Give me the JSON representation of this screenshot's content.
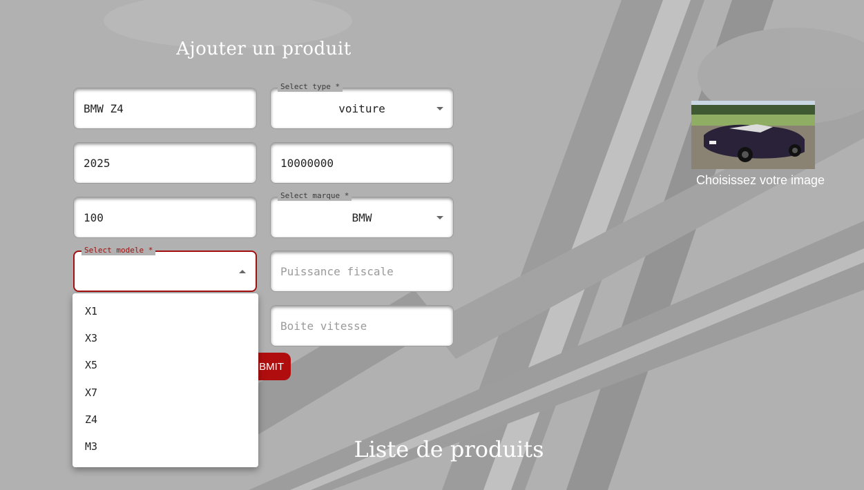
{
  "header": {
    "title": "Ajouter un produit"
  },
  "form": {
    "name_value": "BMW Z4",
    "type": {
      "label": "Select type *",
      "value": "voiture"
    },
    "year_value": "2025",
    "price_value": "10000000",
    "mileage_value": "100",
    "marque": {
      "label": "Select marque *",
      "value": "BMW"
    },
    "modele": {
      "label": "Select modele *",
      "value": ""
    },
    "puissance_placeholder": "Puissance fiscale",
    "boite_placeholder": "Boite vitesse",
    "submit_label": "BMIT"
  },
  "dropdown": {
    "options": [
      "X1",
      "X3",
      "X5",
      "X7",
      "Z4",
      "M3"
    ]
  },
  "image_upload": {
    "caption": "Choisissez votre image"
  },
  "list": {
    "title": "Liste de produits"
  },
  "colors": {
    "accent": "#b00e0e",
    "background": "#b1b1b1",
    "focus_border": "#a30f0f"
  }
}
